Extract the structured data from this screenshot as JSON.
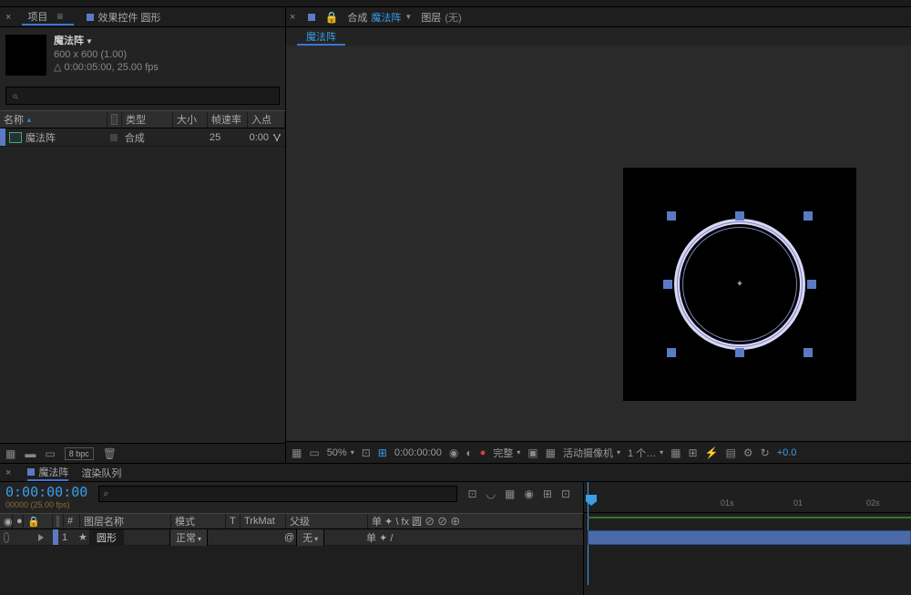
{
  "project": {
    "tab_project": "项目",
    "tab_effects": "效果控件 圆形",
    "title": "魔法阵",
    "dimensions": "600 x 600 (1.00)",
    "duration": "0:00:05:00, 25.00 fps",
    "columns": {
      "name": "名称",
      "type": "类型",
      "size": "大小",
      "fps": "帧速率",
      "inpoint": "入点"
    },
    "item": {
      "name": "魔法阵",
      "type": "合成",
      "fps": "25",
      "inpoint": "0:00"
    },
    "bpc": "8 bpc"
  },
  "viewer": {
    "lock": "🔒",
    "comp_label": "合成",
    "comp_name": "魔法阵",
    "layer_label": "图层",
    "layer_none": "(无)",
    "subtab": "魔法阵",
    "controls": {
      "zoom": "50%",
      "time": "0:00:00:00",
      "resolution": "完整",
      "camera": "活动摄像机",
      "views": "1 个…",
      "exposure": "+0.0"
    }
  },
  "timeline": {
    "tab_comp": "魔法阵",
    "tab_render": "渲染队列",
    "timecode": "0:00:00:00",
    "timecode_sub": "00000 (25.00 fps)",
    "columns": {
      "index": "#",
      "layer_name": "图层名称",
      "mode": "模式",
      "t": "T",
      "trkmat": "TrkMat",
      "parent": "父级",
      "switches": "单 ✦ \\ fx 圆 ⊘ ⊘ ⊕"
    },
    "layer": {
      "index": "1",
      "name": "圆形",
      "mode": "正常",
      "parent": "无",
      "sw": "单 ✦ /"
    },
    "ruler": {
      "t1": "01s",
      "t2": "01",
      "t3": "02s"
    }
  }
}
